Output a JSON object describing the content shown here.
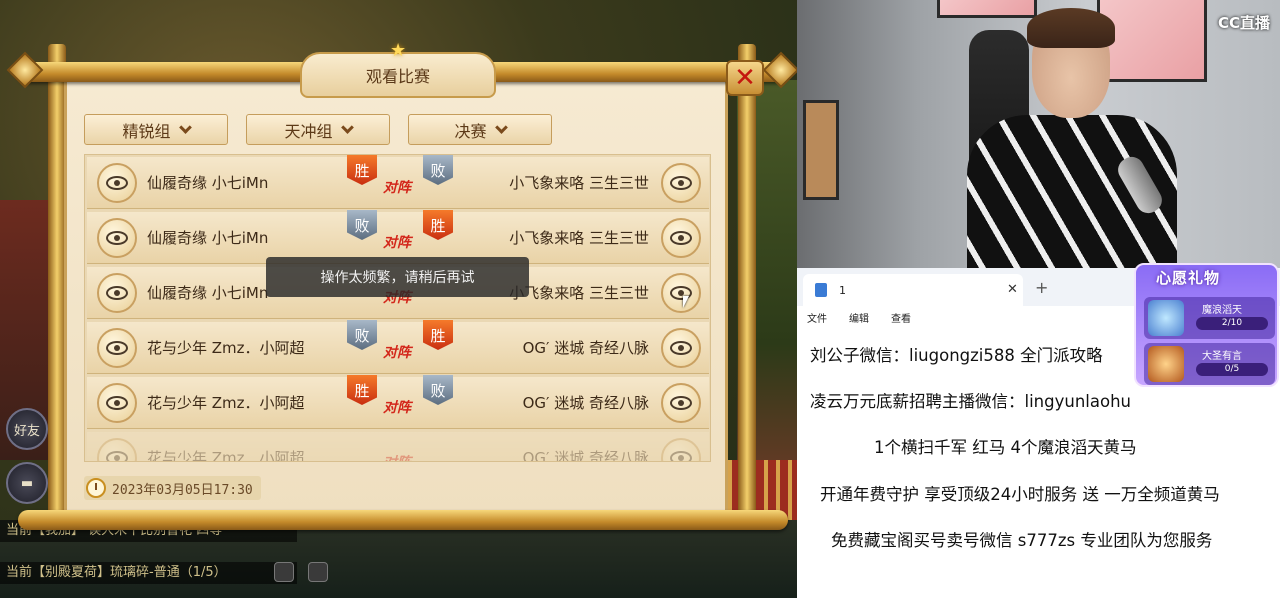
{
  "dialog": {
    "title": "观看比赛",
    "filters": [
      "精锐组",
      "天冲组",
      "决赛"
    ],
    "date": "2023年03月05日17:30",
    "toast": "操作太频繁，请稍后再试",
    "vs_label": "对阵"
  },
  "matches": [
    {
      "left": "仙履奇缘  小七iMn",
      "right": "小飞象来咯  三生三世",
      "left_result": "胜",
      "right_result": "败"
    },
    {
      "left": "仙履奇缘  小七iMn",
      "right": "小飞象来咯  三生三世",
      "left_result": "败",
      "right_result": "胜"
    },
    {
      "left": "仙履奇缘  小七iMn",
      "right": "小飞象来咯  三生三世",
      "left_result": "",
      "right_result": ""
    },
    {
      "left": "花与少年  Zmz．小阿超",
      "right": "OG′ 迷城  奇经八脉",
      "left_result": "败",
      "right_result": "胜"
    },
    {
      "left": "花与少年  Zmz．小阿超",
      "right": "OG′ 迷城  奇经八脉",
      "left_result": "胜",
      "right_result": "败"
    }
  ],
  "game_ui": {
    "friends_label": "好友",
    "chat_lines": [
      "当前【我加】 诶大米十比别曾花 四等一",
      "当前【别殿夏荷】琉璃碎-普通（1/5）"
    ]
  },
  "stream": {
    "logo": "CC直播"
  },
  "notepad": {
    "tab_title": "1",
    "menu": [
      "文件",
      "编辑",
      "查看"
    ],
    "lines": [
      "刘公子微信：liugongzi588 全门派攻略",
      "凌云万元底薪招聘主播微信：lingyunlaohu",
      "1个横扫千军 红马    4个魔浪滔天黄马",
      "开通年费守护 享受顶级24小时服务 送 一万全频道黄马",
      "免费藏宝阁买号卖号微信 s777zs 专业团队为您服务"
    ]
  },
  "gift_panel": {
    "title": "心愿礼物",
    "items": [
      {
        "name": "魔浪滔天",
        "progress": "2/10"
      },
      {
        "name": "大圣有言",
        "progress": "0/5"
      }
    ]
  }
}
